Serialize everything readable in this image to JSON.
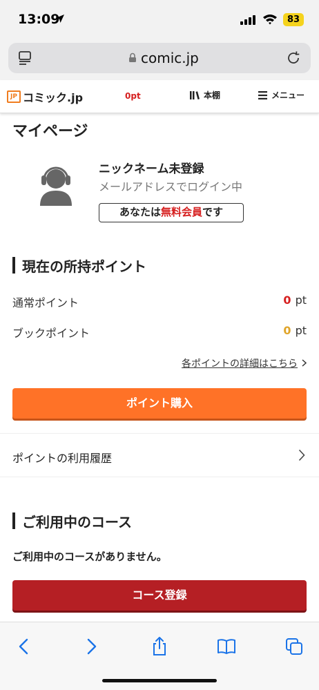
{
  "status_bar": {
    "time": "13:09",
    "battery": "83",
    "battery_color": "#f5d31d"
  },
  "browser": {
    "url": "comic.jp"
  },
  "header": {
    "logo_box": "JP",
    "logo_text": "コミック.jp",
    "points": "0pt",
    "bookshelf": "本棚",
    "menu": "メニュー"
  },
  "mypage": {
    "title": "マイページ",
    "nickname": "ニックネーム未登録",
    "login_note": "メールアドレスでログイン中",
    "badge_pre": "あなたは",
    "badge_free": "無料会員",
    "badge_post": "です"
  },
  "points_section": {
    "title": "現在の所持ポイント",
    "normal_label": "通常ポイント",
    "normal_value": "0",
    "book_label": "ブックポイント",
    "book_value": "0",
    "unit": "pt",
    "detail_link": "各ポイントの詳細はこちら",
    "buy_button": "ポイント購入"
  },
  "history": {
    "label": "ポイントの利用履歴"
  },
  "course_section": {
    "title": "ご利用中のコース",
    "empty": "ご利用中のコースがありません。",
    "register_button": "コース登録"
  },
  "colors": {
    "accent_orange": "#ff7227",
    "accent_red": "#b51f24",
    "points_red": "#d61f1f",
    "book_gold": "#e0a52a",
    "ios_blue": "#1a73e8"
  }
}
